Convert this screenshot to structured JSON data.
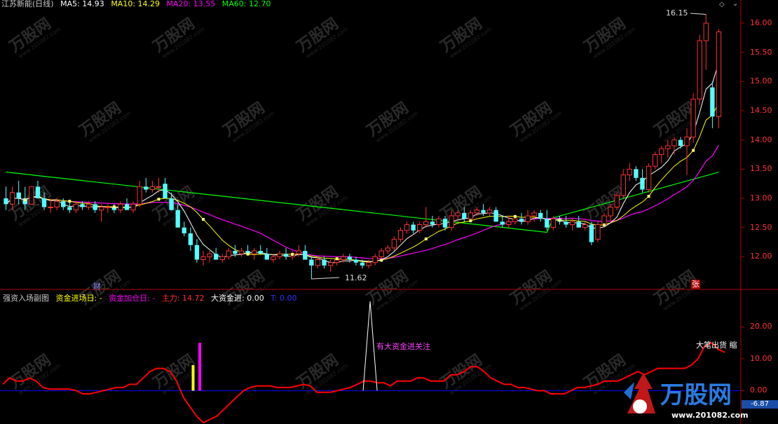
{
  "main_header": {
    "stock": "江苏新能(日线)",
    "ma5": "MA5: 14.93",
    "ma10": "MA10: 14.29",
    "ma20": "MA20: 13.55",
    "ma60": "MA60: 12.70"
  },
  "sub_header": {
    "title": "强资入场副图",
    "entry_day": "资金进场日: -",
    "add_day": "资金加仓日: -",
    "main_force": "主力: 14.72",
    "big_funds": "大资金进: 0.00",
    "t_value": "T: 0.00"
  },
  "annotations": {
    "high": "16.15",
    "low": "11.62",
    "cai_marker": "财",
    "zhang_marker": "张",
    "big_funds_alert": "有大资金进关注",
    "big_order_out": "大笔出货 缩"
  },
  "price_axis": [
    "16.00",
    "15.50",
    "15.00",
    "14.50",
    "14.00",
    "13.50",
    "13.00",
    "12.50",
    "12.00"
  ],
  "indicator_axis": [
    "20.00",
    "10.00",
    "0.00"
  ],
  "indicator_current": "-6.87",
  "watermark": {
    "brand": "万股网",
    "url": "www.201082.com"
  },
  "colors": {
    "up": "#ff3232",
    "down": "#54ffff",
    "ma5": "#ffffff",
    "ma10": "#ffff00",
    "ma20": "#ff00ff",
    "ma60": "#00ff00",
    "main_line": "#ff0000",
    "zero_line": "#0000ff",
    "border": "#b00000"
  },
  "chart_data": {
    "type": "candlestick",
    "ylim": [
      11.5,
      16.3
    ],
    "indicator_ylim": [
      -10,
      28
    ],
    "candles": [
      [
        13.0,
        13.2,
        12.8,
        12.9
      ],
      [
        12.9,
        13.2,
        12.8,
        13.1
      ],
      [
        13.1,
        13.3,
        12.9,
        13.0
      ],
      [
        13.0,
        13.2,
        12.8,
        12.9
      ],
      [
        12.9,
        13.2,
        12.9,
        13.2
      ],
      [
        13.2,
        13.3,
        13.0,
        13.0
      ],
      [
        13.0,
        13.1,
        12.8,
        12.85
      ],
      [
        12.85,
        13.0,
        12.75,
        12.85
      ],
      [
        12.85,
        13.0,
        12.8,
        12.95
      ],
      [
        12.95,
        13.0,
        12.8,
        12.85
      ],
      [
        12.85,
        12.95,
        12.75,
        12.8
      ],
      [
        12.8,
        12.95,
        12.75,
        12.9
      ],
      [
        12.9,
        12.95,
        12.8,
        12.85
      ],
      [
        12.85,
        12.95,
        12.8,
        12.9
      ],
      [
        12.9,
        12.95,
        12.75,
        12.8
      ],
      [
        12.8,
        12.9,
        12.6,
        12.85
      ],
      [
        12.85,
        12.9,
        12.75,
        12.85
      ],
      [
        12.85,
        12.9,
        12.75,
        12.8
      ],
      [
        12.8,
        12.95,
        12.75,
        12.9
      ],
      [
        12.9,
        13.0,
        12.8,
        12.8
      ],
      [
        12.8,
        12.95,
        12.75,
        12.9
      ],
      [
        12.9,
        13.3,
        12.85,
        13.2
      ],
      [
        13.2,
        13.35,
        13.1,
        13.15
      ],
      [
        13.15,
        13.3,
        13.1,
        13.2
      ],
      [
        13.2,
        13.35,
        13.1,
        13.2
      ],
      [
        13.25,
        13.35,
        13.0,
        13.0
      ],
      [
        13.0,
        13.1,
        12.8,
        12.8
      ],
      [
        12.8,
        12.9,
        12.5,
        12.5
      ],
      [
        12.5,
        12.6,
        12.35,
        12.4
      ],
      [
        12.4,
        12.5,
        12.1,
        12.2
      ],
      [
        12.2,
        12.3,
        11.9,
        11.95
      ],
      [
        11.95,
        12.1,
        11.85,
        12.0
      ],
      [
        12.0,
        12.1,
        11.9,
        12.05
      ],
      [
        12.05,
        12.15,
        11.95,
        11.95
      ],
      [
        11.95,
        12.05,
        11.9,
        12.0
      ],
      [
        12.0,
        12.15,
        11.95,
        12.1
      ],
      [
        12.1,
        12.2,
        12.0,
        12.05
      ],
      [
        12.05,
        12.15,
        12.0,
        12.1
      ],
      [
        12.1,
        12.2,
        12.05,
        12.05
      ],
      [
        12.05,
        12.15,
        11.95,
        12.1
      ],
      [
        12.1,
        12.2,
        12.05,
        12.05
      ],
      [
        12.05,
        12.15,
        11.95,
        11.95
      ],
      [
        11.95,
        12.05,
        11.9,
        12.0
      ],
      [
        12.0,
        12.1,
        11.95,
        12.05
      ],
      [
        12.05,
        12.15,
        11.95,
        12.0
      ],
      [
        12.0,
        12.1,
        11.95,
        12.05
      ],
      [
        12.05,
        12.2,
        12.0,
        12.1
      ],
      [
        12.1,
        12.2,
        11.95,
        11.95
      ],
      [
        11.95,
        12.0,
        11.62,
        11.85
      ],
      [
        11.85,
        12.0,
        11.8,
        11.95
      ],
      [
        11.95,
        12.0,
        11.8,
        11.85
      ],
      [
        11.85,
        11.95,
        11.75,
        11.9
      ],
      [
        11.9,
        12.0,
        11.85,
        11.95
      ],
      [
        11.95,
        12.05,
        11.9,
        12.0
      ],
      [
        12.0,
        12.05,
        11.9,
        11.95
      ],
      [
        11.95,
        12.0,
        11.85,
        11.9
      ],
      [
        11.9,
        11.95,
        11.8,
        11.85
      ],
      [
        11.85,
        11.95,
        11.8,
        11.9
      ],
      [
        11.9,
        12.05,
        11.85,
        12.0
      ],
      [
        12.0,
        12.15,
        11.95,
        12.1
      ],
      [
        12.1,
        12.2,
        12.05,
        12.15
      ],
      [
        12.15,
        12.35,
        12.1,
        12.3
      ],
      [
        12.3,
        12.5,
        12.25,
        12.45
      ],
      [
        12.45,
        12.6,
        12.4,
        12.55
      ],
      [
        12.55,
        12.6,
        12.4,
        12.45
      ],
      [
        12.45,
        12.6,
        12.4,
        12.55
      ],
      [
        12.55,
        12.85,
        12.5,
        12.6
      ],
      [
        12.6,
        12.7,
        12.5,
        12.55
      ],
      [
        12.55,
        12.7,
        12.5,
        12.65
      ],
      [
        12.65,
        12.7,
        12.45,
        12.5
      ],
      [
        12.5,
        12.8,
        12.45,
        12.7
      ],
      [
        12.7,
        12.8,
        12.6,
        12.75
      ],
      [
        12.75,
        12.85,
        12.6,
        12.65
      ],
      [
        12.65,
        12.8,
        12.6,
        12.75
      ],
      [
        12.75,
        12.85,
        12.7,
        12.8
      ],
      [
        12.8,
        12.9,
        12.7,
        12.75
      ],
      [
        12.75,
        12.85,
        12.7,
        12.8
      ],
      [
        12.8,
        12.85,
        12.6,
        12.6
      ],
      [
        12.6,
        12.7,
        12.5,
        12.55
      ],
      [
        12.55,
        12.7,
        12.5,
        12.6
      ],
      [
        12.6,
        12.7,
        12.55,
        12.65
      ],
      [
        12.65,
        12.75,
        12.55,
        12.6
      ],
      [
        12.6,
        12.8,
        12.55,
        12.7
      ],
      [
        12.7,
        12.8,
        12.6,
        12.75
      ],
      [
        12.75,
        12.8,
        12.6,
        12.65
      ],
      [
        12.65,
        12.8,
        12.45,
        12.5
      ],
      [
        12.5,
        12.7,
        12.45,
        12.65
      ],
      [
        12.65,
        12.7,
        12.55,
        12.6
      ],
      [
        12.6,
        12.7,
        12.5,
        12.55
      ],
      [
        12.55,
        12.65,
        12.45,
        12.6
      ],
      [
        12.6,
        12.7,
        12.5,
        12.5
      ],
      [
        12.5,
        12.6,
        12.45,
        12.55
      ],
      [
        12.55,
        12.6,
        12.2,
        12.25
      ],
      [
        12.3,
        12.6,
        12.25,
        12.55
      ],
      [
        12.55,
        12.75,
        12.5,
        12.7
      ],
      [
        12.7,
        12.9,
        12.6,
        12.85
      ],
      [
        12.85,
        13.1,
        12.8,
        13.05
      ],
      [
        13.05,
        13.5,
        13.0,
        13.4
      ],
      [
        13.4,
        13.6,
        13.3,
        13.5
      ],
      [
        13.5,
        13.55,
        13.3,
        13.35
      ],
      [
        13.35,
        13.5,
        13.1,
        13.15
      ],
      [
        13.15,
        13.6,
        13.1,
        13.55
      ],
      [
        13.55,
        13.8,
        13.5,
        13.75
      ],
      [
        13.75,
        13.9,
        13.6,
        13.85
      ],
      [
        13.85,
        14.0,
        13.7,
        13.9
      ],
      [
        13.9,
        14.05,
        13.75,
        14.0
      ],
      [
        14.0,
        14.05,
        13.85,
        13.9
      ],
      [
        13.9,
        14.2,
        13.4,
        14.05
      ],
      [
        14.05,
        14.8,
        13.95,
        14.7
      ],
      [
        14.7,
        15.8,
        14.6,
        15.7
      ],
      [
        15.7,
        16.15,
        15.2,
        16.0
      ],
      [
        14.9,
        15.0,
        14.2,
        14.4
      ],
      [
        14.4,
        15.9,
        14.2,
        15.85
      ]
    ],
    "indicator_main_force": [
      2,
      4,
      3,
      3,
      4,
      3,
      1,
      0.5,
      0.5,
      0.5,
      0.5,
      0,
      -1,
      -1,
      -0.5,
      0,
      0.5,
      1,
      1,
      2,
      2,
      4,
      6,
      7,
      7,
      6,
      3,
      -2,
      -5,
      -8,
      -10,
      -9,
      -8,
      -6,
      -4,
      -2,
      0,
      1,
      1.5,
      1.5,
      1.5,
      1,
      1,
      1,
      1.5,
      2,
      1.5,
      -0.5,
      -0.5,
      -0.5,
      0,
      0.5,
      1,
      2,
      3,
      3,
      2.5,
      2.5,
      1.5,
      3,
      3,
      3,
      4,
      4,
      3,
      3,
      3,
      5,
      5,
      6,
      7.5,
      7.5,
      6,
      4,
      3,
      2,
      2,
      1,
      1,
      0.5,
      0,
      0,
      -1,
      -1,
      -1,
      0,
      1,
      1,
      1.5,
      2,
      3,
      3,
      3,
      4,
      5,
      6,
      5,
      6,
      7,
      7,
      7,
      7,
      7,
      8,
      10,
      14,
      15,
      13,
      12
    ],
    "indicator_bars": [
      {
        "index": 27,
        "value": 8,
        "color": "#ffff00"
      },
      {
        "index": 28,
        "value": 15,
        "color": "#ff00ff"
      }
    ],
    "indicator_spike": {
      "index": 56,
      "value": 28
    }
  }
}
